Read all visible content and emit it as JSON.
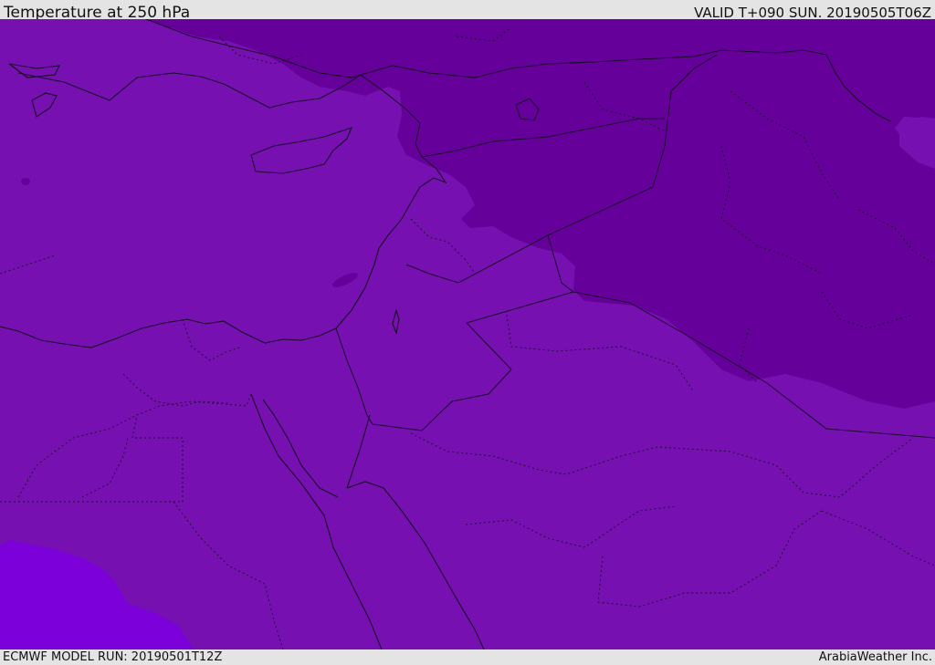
{
  "header": {
    "title": "Temperature at 250 hPa",
    "valid_time": "VALID T+090 SUN. 20190505T06Z"
  },
  "footer": {
    "model_run": "ECMWF MODEL RUN: 20190501T12Z",
    "credit": "ArabiaWeather Inc."
  },
  "colors": {
    "base_field": "#7610b0",
    "cold_field": "#66009a",
    "warm_field": "#7b00d9",
    "boundaries": "#1a0a2a",
    "bar_background": "#e4e4e4"
  }
}
